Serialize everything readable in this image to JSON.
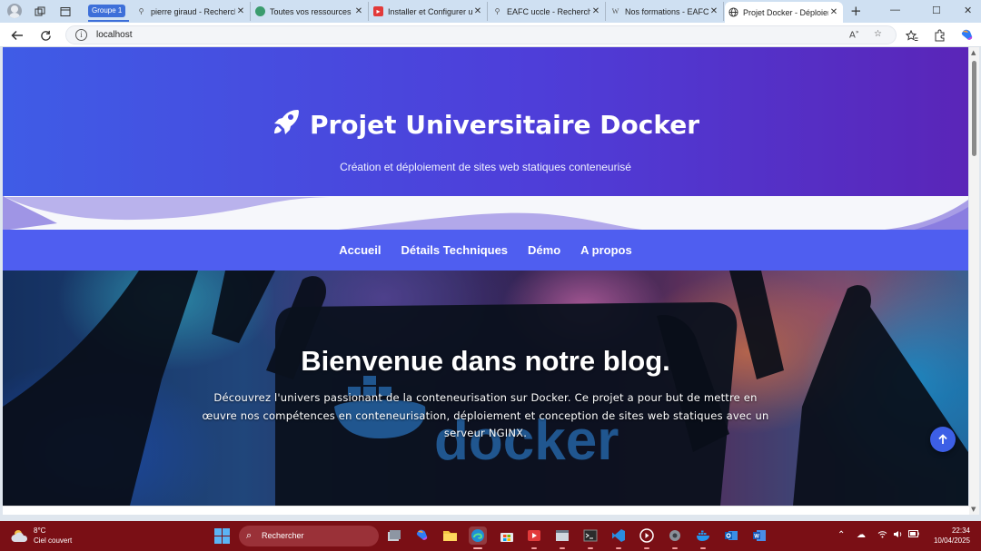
{
  "browser": {
    "tab_group": "Groupe 1",
    "tabs": [
      {
        "label": "pierre giraud - Recherche",
        "favicon": "search-icon"
      },
      {
        "label": "Toutes vos ressources sur",
        "favicon": "globe-icon"
      },
      {
        "label": "Installer et Configurer un",
        "favicon": "youtube-icon"
      },
      {
        "label": "EAFC uccle - Recherche",
        "favicon": "search-icon"
      },
      {
        "label": "Nos formations - EAFC",
        "favicon": "wiki-icon"
      },
      {
        "label": "Projet Docker - Déploiement",
        "favicon": "globe-icon",
        "active": true
      }
    ],
    "url": "localhost",
    "window_controls": [
      "minimize",
      "maximize",
      "close"
    ]
  },
  "page": {
    "header": {
      "title": "Projet Universitaire Docker",
      "subtitle": "Création et déploiement de sites web statiques conteneurisé",
      "gradient_colors": [
        "#3f5ce6",
        "#4e3ed9",
        "#5a25b8"
      ]
    },
    "nav": {
      "items": [
        "Accueil",
        "Détails Techniques",
        "Démo",
        "A propos"
      ],
      "background": "#4f5ef0"
    },
    "hero": {
      "title": "Bienvenue dans notre blog.",
      "text": "Découvrez l'univers passionant de la conteneurisation sur Docker. Ce projet a pour but de mettre en œuvre nos compétences en conteneurisation, déploiement et conception de sites web statiques avec un serveur NGINX.",
      "background_word": "docker"
    },
    "scroll_top_icon": "arrow-up-icon"
  },
  "taskbar": {
    "weather": {
      "temp": "8°C",
      "desc": "Ciel couvert"
    },
    "search_placeholder": "Rechercher",
    "apps": [
      "file-manager",
      "copilot",
      "explorer",
      "edge",
      "store",
      "media",
      "terminal",
      "vscode",
      "player",
      "settings",
      "docker",
      "outlook",
      "word"
    ],
    "clock": {
      "time": "22:34",
      "date": "10/04/2025"
    },
    "color": "#7a0f15"
  }
}
